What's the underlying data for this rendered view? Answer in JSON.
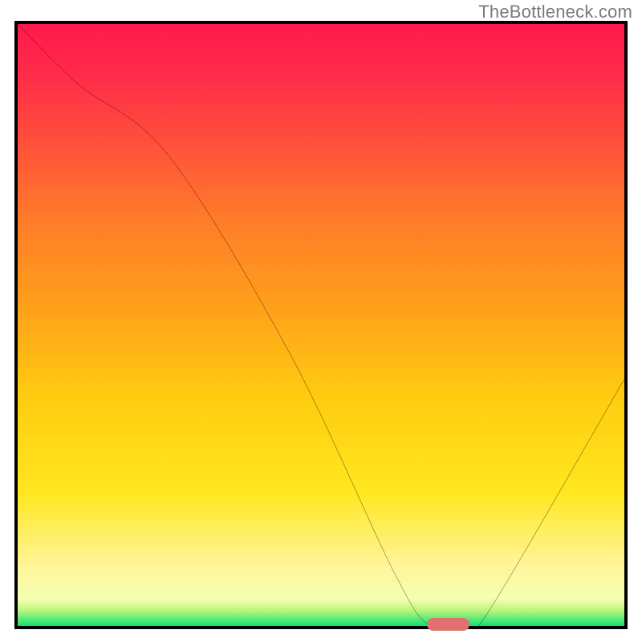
{
  "watermark": "TheBottleneck.com",
  "colors": {
    "border": "#000000",
    "gradient_top": "#ff1a4d",
    "gradient_mid1": "#ff6a2a",
    "gradient_mid2": "#ffd400",
    "gradient_mid3": "#fff59a",
    "gradient_bottom": "#17e06a",
    "curve": "#000000",
    "marker": "#e17070"
  },
  "chart_data": {
    "type": "line",
    "title": "",
    "xlabel": "",
    "ylabel": "",
    "xlim": [
      0,
      100
    ],
    "ylim": [
      0,
      100
    ],
    "x": [
      0,
      10,
      25,
      45,
      62,
      68,
      74,
      78,
      100
    ],
    "values": [
      100,
      90,
      78,
      45,
      9,
      0,
      0,
      3,
      41
    ],
    "marker": {
      "x_start": 68,
      "x_end": 74,
      "y": 0
    },
    "notes": "Values read visually from chart; y=0 corresponds to green bottom edge, y=100 to red top edge."
  }
}
